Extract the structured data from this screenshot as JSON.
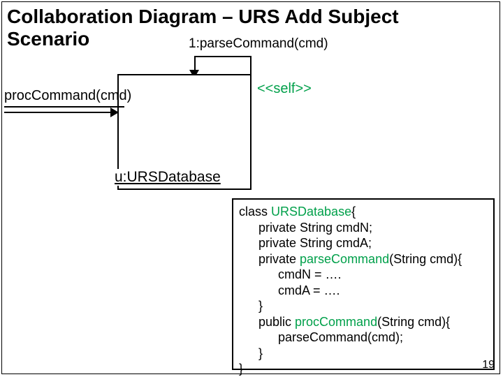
{
  "title": "Collaboration Diagram – URS Add Subject Scenario",
  "msg1": "1:parseCommand(cmd)",
  "selfLabel": "<<self>>",
  "procLabel": "procCommand(cmd)",
  "objectName": "u:URSDatabase",
  "code": {
    "l1a": "class ",
    "l1b": "URSDatabase",
    "l1c": "{",
    "l2": "private String cmdN;",
    "l3": "private String cmdA;",
    "l4a": "private ",
    "l4b": "parseCommand",
    "l4c": "(String cmd){",
    "l5": "cmdN = ….",
    "l6": "cmdA = ….",
    "l7": "}",
    "l8a": "public ",
    "l8b": "procCommand",
    "l8c": "(String cmd){",
    "l9": "parseCommand(cmd);",
    "l10": "}",
    "l11": "}"
  },
  "pageNum": "19"
}
